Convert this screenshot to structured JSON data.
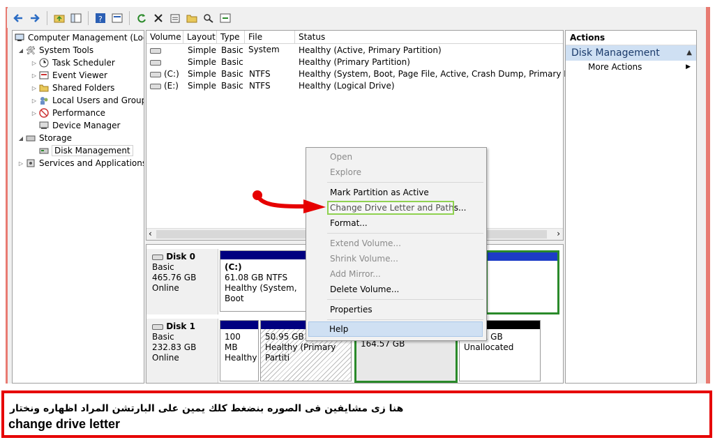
{
  "toolbar": {
    "icons": [
      "back-arrow-icon",
      "forward-arrow-icon",
      "up-folder-icon",
      "show-hide-tree-icon",
      "help-icon",
      "console-icon",
      "refresh-icon",
      "delete-icon",
      "properties-icon",
      "open-folder-icon",
      "search-icon",
      "rescan-icon"
    ]
  },
  "tree": {
    "root": "Computer Management (Local",
    "system_tools": "System Tools",
    "task_scheduler": "Task Scheduler",
    "event_viewer": "Event Viewer",
    "shared_folders": "Shared Folders",
    "local_users": "Local Users and Groups",
    "performance": "Performance",
    "device_manager": "Device Manager",
    "storage": "Storage",
    "disk_management": "Disk Management",
    "services": "Services and Applications"
  },
  "volumes": {
    "headers": [
      "Volume",
      "Layout",
      "Type",
      "File System",
      "Status"
    ],
    "rows": [
      {
        "volume": "",
        "layout": "Simple",
        "type": "Basic",
        "fs": "",
        "status": "Healthy (Active, Primary Partition)"
      },
      {
        "volume": "",
        "layout": "Simple",
        "type": "Basic",
        "fs": "",
        "status": "Healthy (Primary Partition)"
      },
      {
        "volume": "(C:)",
        "layout": "Simple",
        "type": "Basic",
        "fs": "NTFS",
        "status": "Healthy (System, Boot, Page File, Active, Crash Dump, Primary Partition)"
      },
      {
        "volume": "(E:)",
        "layout": "Simple",
        "type": "Basic",
        "fs": "NTFS",
        "status": "Healthy (Logical Drive)"
      }
    ]
  },
  "disks": {
    "disk0": {
      "name": "Disk 0",
      "type": "Basic",
      "size": "465.76 GB",
      "state": "Online",
      "c_label": "(C:)",
      "c_size": "61.08 GB NTFS",
      "c_status": "Healthy (System, Boot"
    },
    "disk1": {
      "name": "Disk 1",
      "type": "Basic",
      "size": "232.83 GB",
      "state": "Online",
      "p1_size": "100 MB",
      "p1_status": "Healthy",
      "p2_size": "50.95 GB",
      "p2_status": "Healthy (Primary Partiti",
      "p3_size": "164.57 GB",
      "p4_size": "17.21 GB",
      "p4_status": "Unallocated"
    }
  },
  "actions": {
    "header": "Actions",
    "section": "Disk Management",
    "more": "More Actions"
  },
  "context_menu": {
    "open": "Open",
    "explore": "Explore",
    "mark_active": "Mark Partition as Active",
    "change_letter": "Change Drive Letter and Paths...",
    "format": "Format...",
    "extend": "Extend Volume...",
    "shrink": "Shrink Volume...",
    "add_mirror": "Add Mirror...",
    "delete": "Delete Volume...",
    "properties": "Properties",
    "help": "Help"
  },
  "caption": {
    "arabic": "هنا  زى مشايفين فى الصوره بنضغط كلك يمين على البارتشن المراد اظهاره  ونختار",
    "english": "change drive letter"
  },
  "colors": {
    "primary_bar": "#000080",
    "logical_border": "#2a8a2a",
    "highlight": "#8fd150",
    "annotation": "#e60000"
  }
}
